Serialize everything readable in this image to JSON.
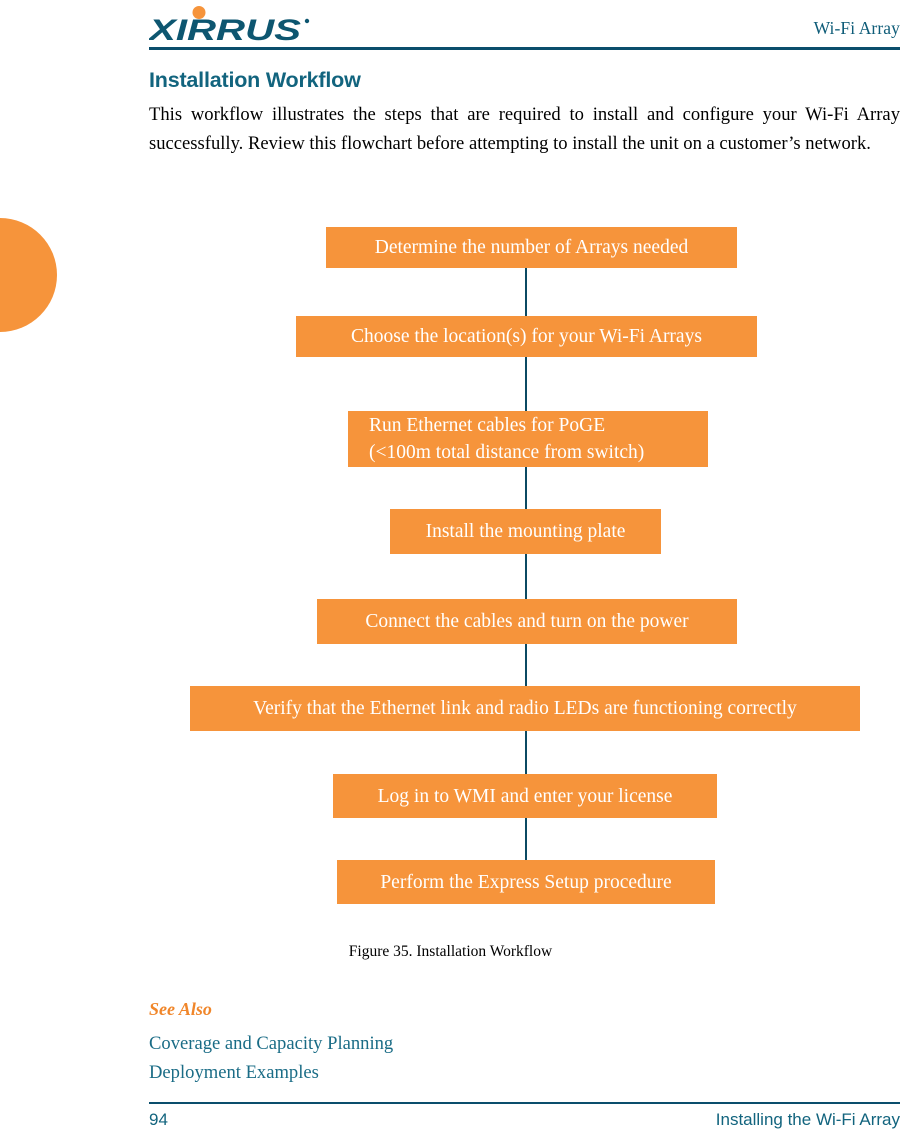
{
  "header": {
    "logo_text": "XIRRUS",
    "logo_icon": "xirrus-logo",
    "title": "Wi-Fi Array"
  },
  "page": {
    "heading": "Installation Workflow",
    "intro": "This workflow illustrates the steps that are required to install and configure your Wi-Fi Array successfully. Review this flowchart before attempting to install the unit on a customer’s network."
  },
  "flowchart": {
    "caption": "Figure 35. Installation Workflow",
    "box_color": "#F6943B",
    "connector_color": "#0B4A63",
    "text_color": "#FFFFFF",
    "steps": [
      {
        "label": "Determine the number of Arrays needed",
        "align": "center"
      },
      {
        "label": "Choose the location(s) for your Wi-Fi Arrays",
        "align": "center"
      },
      {
        "label": "Run Ethernet cables for PoGE\n(<100m total distance from switch)",
        "align": "left"
      },
      {
        "label": "Install the mounting plate",
        "align": "center"
      },
      {
        "label": "Connect the cables and turn on the power",
        "align": "center"
      },
      {
        "label": "Verify that the Ethernet link and radio LEDs are functioning correctly",
        "align": "center"
      },
      {
        "label": "Log in to WMI and enter your license",
        "align": "center"
      },
      {
        "label": "Perform the Express Setup procedure",
        "align": "center"
      }
    ]
  },
  "see_also": {
    "title": "See Also",
    "links": [
      "Coverage and Capacity Planning",
      "Deployment Examples"
    ]
  },
  "footer": {
    "page_number": "94",
    "chapter": "Installing the Wi-Fi Array"
  },
  "colors": {
    "orange": "#F6943B",
    "teal": "#12647E",
    "dark_teal": "#0A4E6C",
    "see_also_orange": "#F0862A"
  }
}
